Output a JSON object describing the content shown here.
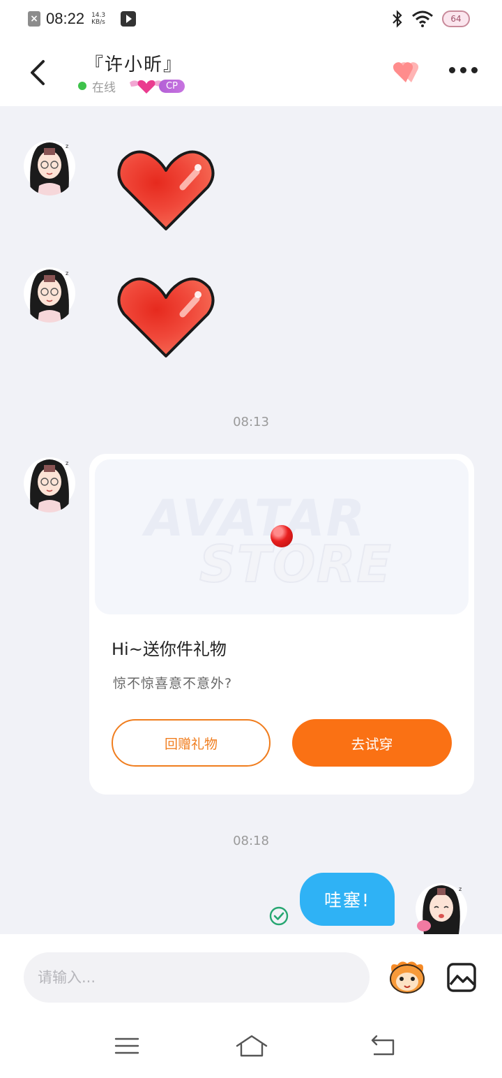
{
  "status_bar": {
    "time": "08:22",
    "speed_value": "14.3",
    "speed_unit": "KB/s",
    "battery": "64"
  },
  "header": {
    "contact_name": "『许小昕』",
    "status": "在线",
    "badge": "CP"
  },
  "messages": {
    "timestamp_1": "08:13",
    "timestamp_2": "08:18",
    "gift_card": {
      "title": "Hi~送你件礼物",
      "subtitle": "惊不惊喜意不意外?",
      "return_button": "回赠礼物",
      "try_button": "去试穿",
      "banner_line_1": "AVATAR",
      "banner_line_2": "STORE"
    },
    "my_message": "哇塞!"
  },
  "input": {
    "placeholder": "请输入..."
  },
  "colors": {
    "accent_orange": "#fa7114",
    "bubble_blue": "#2fb2f5",
    "online_green": "#3ec24b",
    "cp_purple": "#b35fd6"
  },
  "icons": [
    "close-notif-icon",
    "video-play-icon",
    "bluetooth-icon",
    "wifi-icon",
    "battery-icon",
    "back-arrow-icon",
    "heart-icon",
    "more-icon",
    "read-check-icon",
    "emoji-sticker-icon",
    "image-icon",
    "menu-icon",
    "home-icon",
    "back-nav-icon"
  ]
}
